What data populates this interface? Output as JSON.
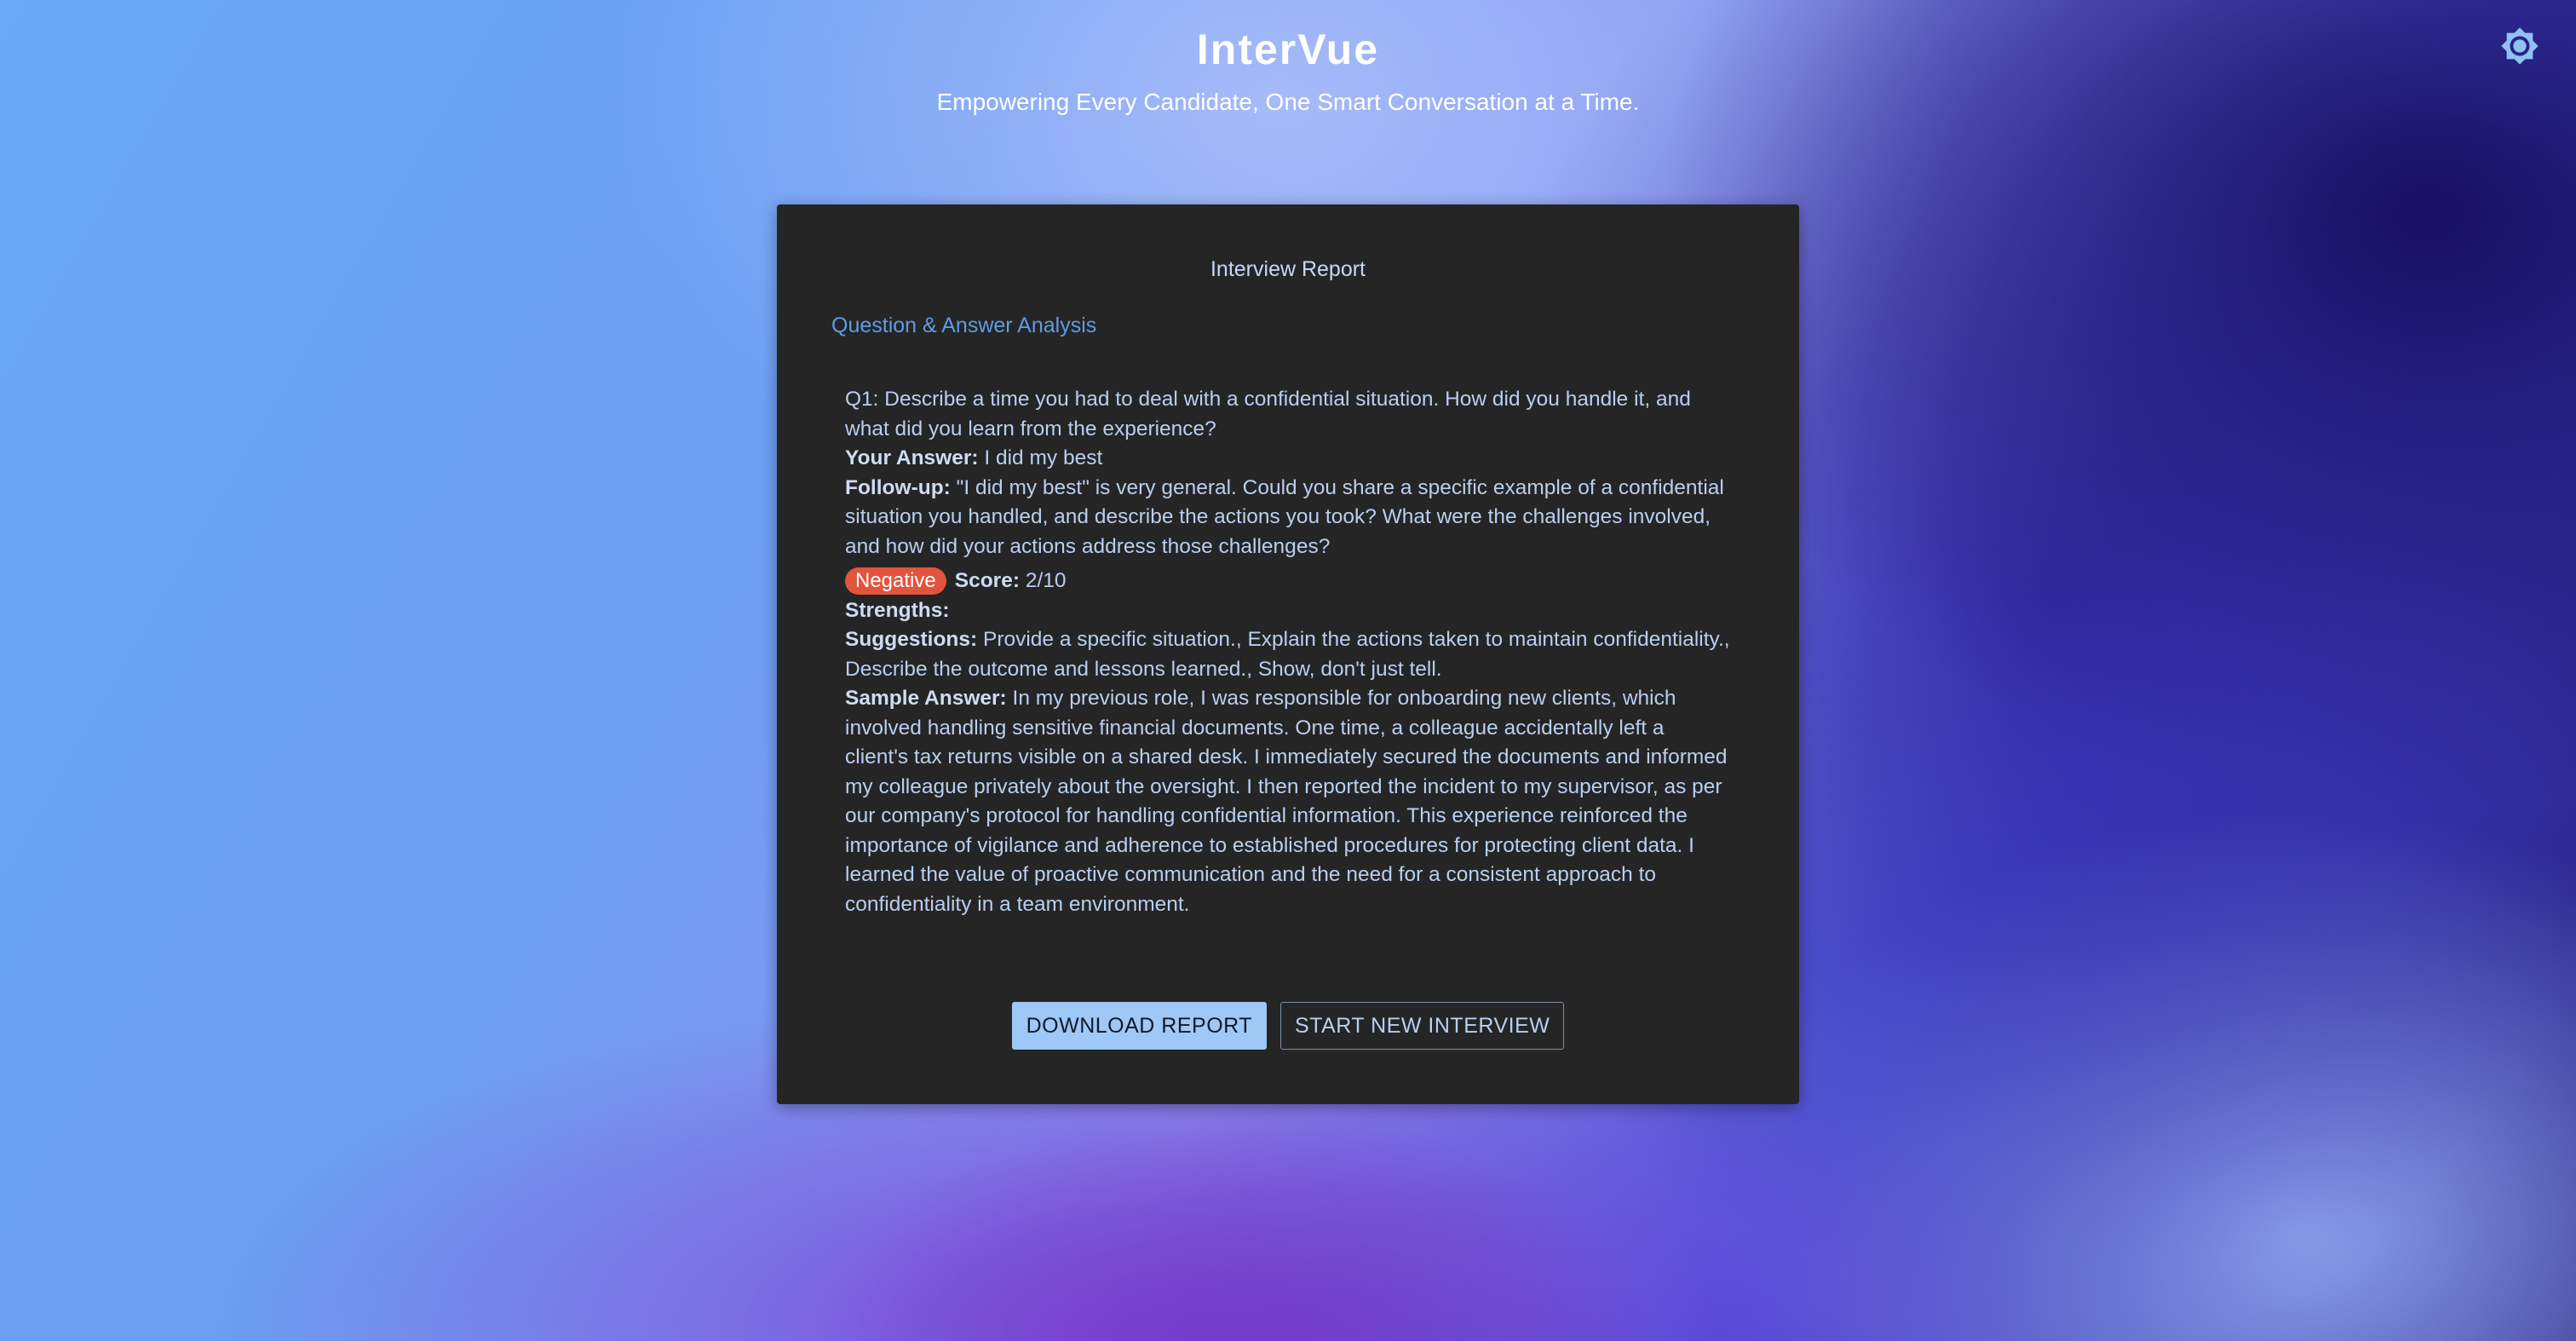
{
  "header": {
    "title": "InterVue",
    "subtitle": "Empowering Every Candidate, One Smart Conversation at a Time."
  },
  "theme_toggle": {
    "icon": "brightness-icon",
    "color": "#8fc1f2"
  },
  "report": {
    "title": "Interview Report",
    "section_title": "Question & Answer Analysis",
    "question": "Q1: Describe a time you had to deal with a confidential situation. How did you handle it, and what did you learn from the experience?",
    "answer_label": "Your Answer:",
    "answer": "I did my best",
    "followup_label": "Follow-up:",
    "followup": "\"I did my best\" is very general. Could you share a specific example of a confidential situation you handled, and describe the actions you took? What were the challenges involved, and how did your actions address those challenges?",
    "sentiment": "Negative",
    "score_label": "Score:",
    "score": "2/10",
    "strengths_label": "Strengths:",
    "strengths": "",
    "suggestions_label": "Suggestions:",
    "suggestions": "Provide a specific situation., Explain the actions taken to maintain confidentiality., Describe the outcome and lessons learned., Show, don't just tell.",
    "sample_label": "Sample Answer:",
    "sample": "In my previous role, I was responsible for onboarding new clients, which involved handling sensitive financial documents. One time, a colleague accidentally left a client's tax returns visible on a shared desk. I immediately secured the documents and informed my colleague privately about the oversight. I then reported the incident to my supervisor, as per our company's protocol for handling confidential information. This experience reinforced the importance of vigilance and adherence to established procedures for protecting client data. I learned the value of proactive communication and the need for a consistent approach to confidentiality in a team environment."
  },
  "actions": {
    "download_label": "DOWNLOAD REPORT",
    "new_interview_label": "START NEW INTERVIEW"
  },
  "colors": {
    "card_background": "#252525",
    "accent": "#5f9be6",
    "negative_badge": "#e2543e",
    "primary_button": "#9ec8f5"
  }
}
